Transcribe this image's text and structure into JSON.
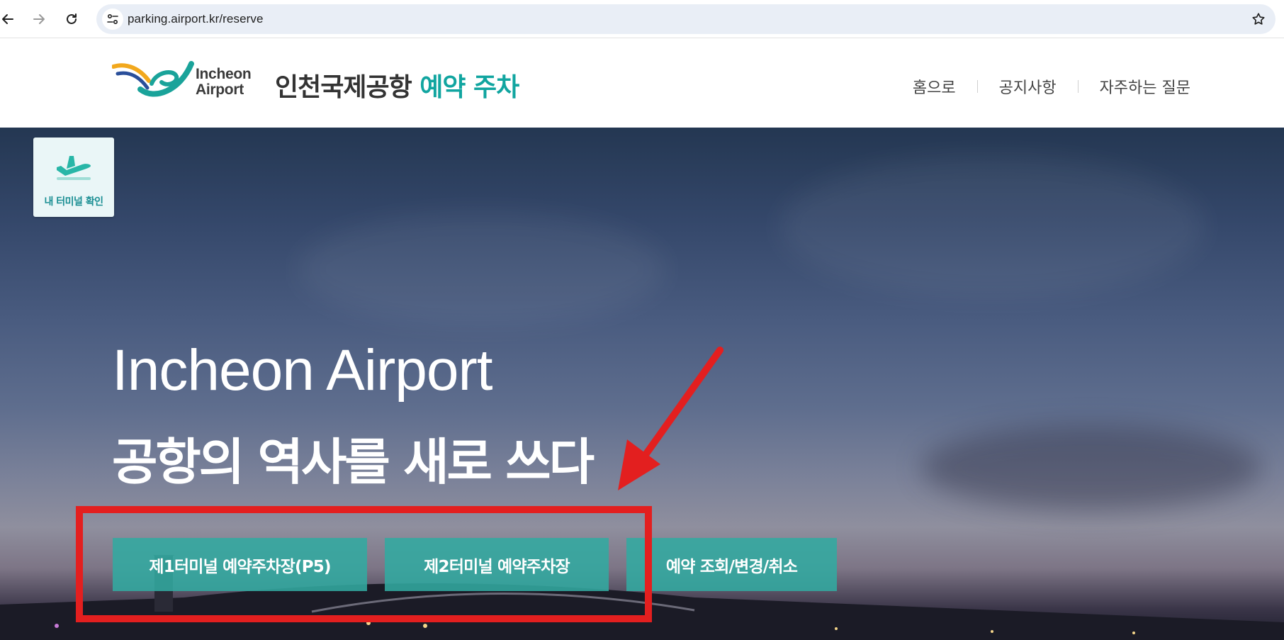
{
  "browser": {
    "url": "parking.airport.kr/reserve",
    "icons": [
      "back-icon",
      "forward-icon",
      "reload-icon",
      "site-info-icon",
      "bookmark-star-icon"
    ]
  },
  "header": {
    "logo_line1": "Incheon",
    "logo_line2": "Airport",
    "title_main": "인천국제공항",
    "title_accent": "예약 주차",
    "nav": [
      "홈으로",
      "공지사항",
      "자주하는 질문"
    ]
  },
  "hero": {
    "terminal_check_label": "내 터미널 확인",
    "headline_en": "Incheon Airport",
    "headline_ko": "공항의 역사를 새로 쓰다",
    "buttons": [
      "제1터미널 예약주차장(P5)",
      "제2터미널 예약주차장",
      "예약 조회/변경/취소"
    ]
  },
  "colors": {
    "accent": "#11a5a0",
    "cta_bg": "#32aaa0",
    "annotation": "#e31f1f"
  }
}
